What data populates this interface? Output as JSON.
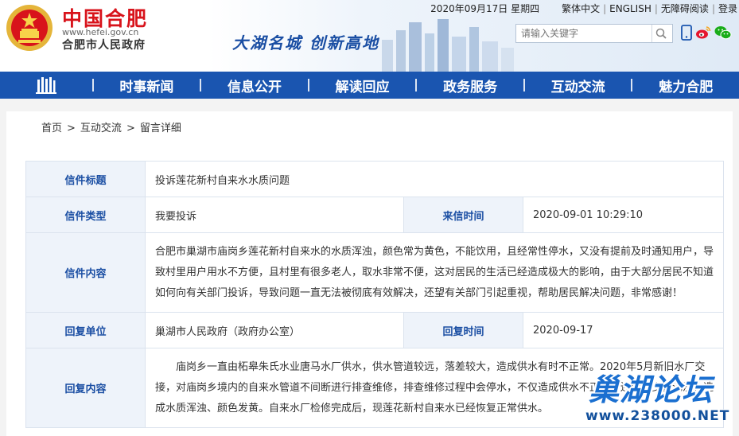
{
  "header": {
    "site_name": "中国合肥",
    "site_url": "www.hefei.gov.cn",
    "site_sub": "合肥市人民政府",
    "slogan": "大湖名城  创新高地",
    "date": "2020年09月17日 星期四",
    "links": [
      "繁体中文",
      "ENGLISH",
      "无障碍阅读",
      "登录"
    ],
    "search_placeholder": "请输入关键字",
    "icons": [
      "search-icon",
      "mobile-icon",
      "weibo-icon",
      "wechat-icon"
    ],
    "brand_color": "#1a55b0",
    "accent_red": "#d8131b"
  },
  "nav": {
    "home_icon": "home-building-icon",
    "items": [
      "时事新闻",
      "信息公开",
      "解读回应",
      "政务服务",
      "互动交流",
      "魅力合肥"
    ]
  },
  "breadcrumb": {
    "items": [
      "首页",
      "互动交流",
      "留言详细"
    ],
    "separator": ">"
  },
  "letter": {
    "title_label": "信件标题",
    "title_value": "投诉莲花新村自来水水质问题",
    "type_label": "信件类型",
    "type_value": "我要投诉",
    "time_label": "来信时间",
    "time_value": "2020-09-01 10:29:10",
    "content_label": "信件内容",
    "content_value": "合肥市巢湖市庙岗乡莲花新村自来水的水质浑浊，颜色常为黄色，不能饮用，且经常性停水，又没有提前及时通知用户，导致村里用户用水不方便，且村里有很多老人，取水非常不便，这对居民的生活已经造成极大的影响，由于大部分居民不知道如何向有关部门投诉，导致问题一直无法被彻底有效解决，还望有关部门引起重视，帮助居民解决问题，非常感谢！",
    "reply_unit_label": "回复单位",
    "reply_unit_value": "巢湖市人民政府（政府办公室）",
    "reply_time_label": "回复时间",
    "reply_time_value": "2020-09-17",
    "reply_content_label": "回复内容",
    "reply_content_value": "庙岗乡一直由柘皋朱氏水业唐马水厂供水，供水管道较远，落差较大，造成供水有时不正常。2020年5月新旧水厂交接，对庙岗乡境内的自来水管道不间断进行排查维修，排查维修过程中会停水，不仅造成供水不正常，还会有少量泥沙，造成水质浑浊、颜色发黄。自来水厂检修完成后，现莲花新村自来水已经恢复正常供水。"
  },
  "watermark": {
    "title": "巢湖论坛",
    "url": "www.238000.NET"
  }
}
